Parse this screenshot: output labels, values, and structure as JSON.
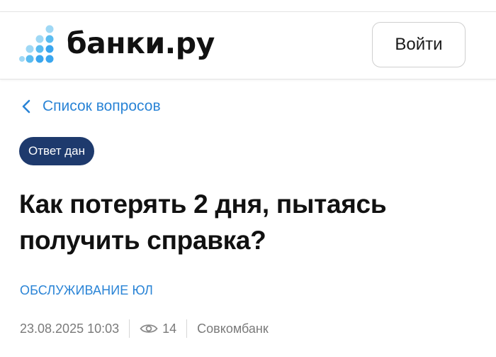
{
  "header": {
    "logo_text": "банки.ру",
    "login_label": "Войти"
  },
  "nav": {
    "back_label": "Список вопросов"
  },
  "question": {
    "status_badge": "Ответ дан",
    "title": "Как потерять 2 дня, пытаясь получить справка?",
    "category": "ОБСЛУЖИВАНИЕ ЮЛ",
    "date": "23.08.2025 10:03",
    "views": "14",
    "bank": "Совкомбанк"
  },
  "colors": {
    "link_blue": "#2a84d6",
    "badge_navy": "#1e3a6d",
    "logo_dots": [
      "#9fd8f5",
      "#5bbcf0",
      "#3aa6ee"
    ]
  },
  "icons": {
    "back": "chevron-left-icon",
    "views": "eye-icon",
    "logo": "dots-logo-icon"
  }
}
